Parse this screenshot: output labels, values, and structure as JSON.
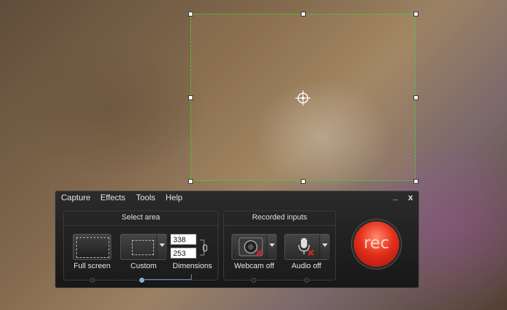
{
  "menu": [
    "Capture",
    "Effects",
    "Tools",
    "Help"
  ],
  "window": {
    "minimize": "_",
    "close": "x"
  },
  "select_area": {
    "title": "Select area",
    "fullscreen_label": "Full screen",
    "custom_label": "Custom",
    "dimensions_label": "Dimensions",
    "width": "338",
    "height": "253"
  },
  "recorded_inputs": {
    "title": "Recorded inputs",
    "webcam_label": "Webcam off",
    "audio_label": "Audio off"
  },
  "rec_label": "rec",
  "colors": {
    "selection": "#3cd33c",
    "rec": "#e5301c"
  }
}
